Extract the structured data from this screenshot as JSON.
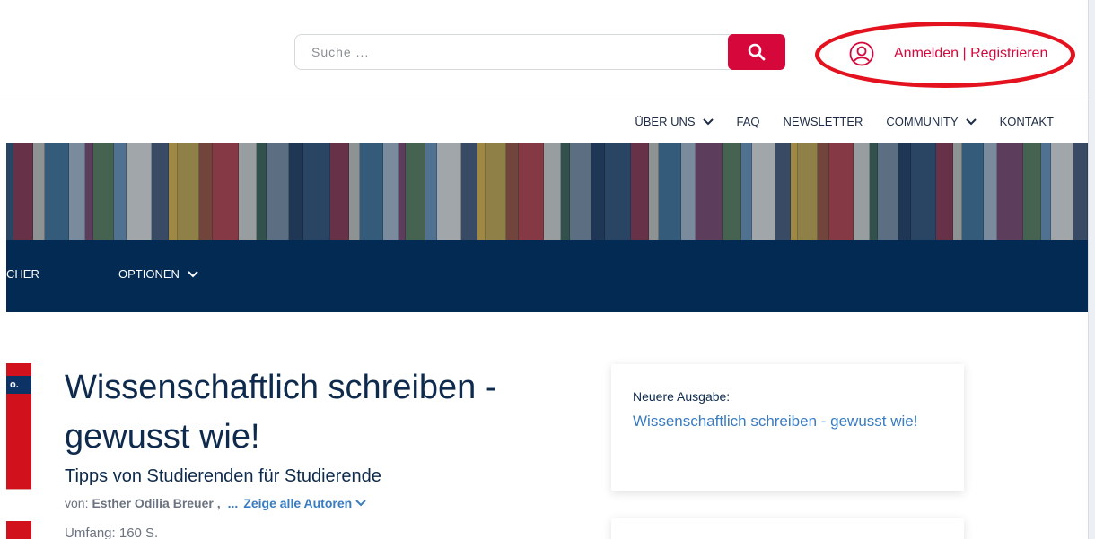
{
  "search": {
    "placeholder": "Suche ..."
  },
  "account": {
    "login_label": "Anmelden | Registrieren"
  },
  "secondary_nav": [
    {
      "label": "ÜBER UNS",
      "has_dropdown": true
    },
    {
      "label": "FAQ",
      "has_dropdown": false
    },
    {
      "label": "NEWSLETTER",
      "has_dropdown": false
    },
    {
      "label": "COMMUNITY",
      "has_dropdown": true
    },
    {
      "label": "KONTAKT",
      "has_dropdown": false
    }
  ],
  "main_nav": [
    {
      "label": "CHER",
      "has_dropdown": false
    },
    {
      "label": "OPTIONEN",
      "has_dropdown": true
    }
  ],
  "book_cover": {
    "badge_text": "o."
  },
  "product": {
    "title": "Wissenschaftlich schreiben - gewusst wie!",
    "subtitle": "Tipps von Studierenden für Studierende",
    "authors_prefix": "von:",
    "author_name": "Esther Odilia Breuer ,",
    "authors_ellipsis": "...",
    "show_all_authors": "Zeige alle Autoren",
    "extent": "Umfang: 160 S."
  },
  "newer_edition": {
    "label": "Neuere Ausgabe:",
    "link_text": "Wissenschaftlich schreiben - gewusst wie!"
  },
  "colors": {
    "brand_red": "#d6083b",
    "nav_blue": "#022a52",
    "link_blue": "#3a7cc0",
    "highlight_red": "#e3121e"
  },
  "icons": {
    "search": "search-icon",
    "user": "user-circle-icon",
    "chevron": "chevron-down-icon"
  }
}
